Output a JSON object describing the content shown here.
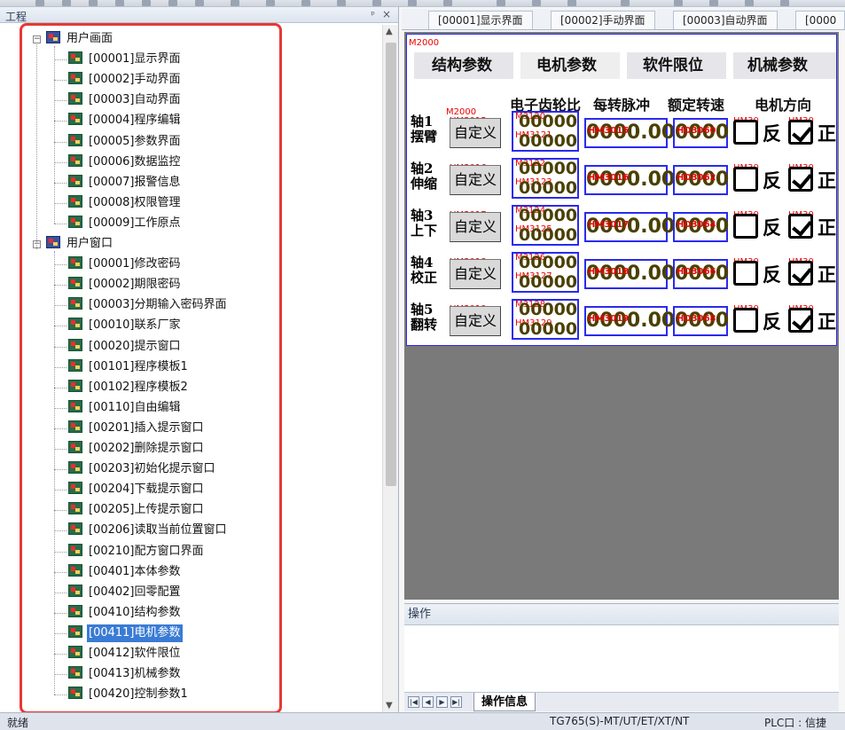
{
  "pane": {
    "title": "工程",
    "pin": "ᵖ",
    "close": "×"
  },
  "tree": {
    "groups": [
      {
        "label": "用户画面",
        "items": [
          "[00001]显示界面",
          "[00002]手动界面",
          "[00003]自动界面",
          "[00004]程序编辑",
          "[00005]参数界面",
          "[00006]数据监控",
          "[00007]报警信息",
          "[00008]权限管理",
          "[00009]工作原点"
        ]
      },
      {
        "label": "用户窗口",
        "items": [
          "[00001]修改密码",
          "[00002]期限密码",
          "[00003]分期输入密码界面",
          "[00010]联系厂家",
          "[00020]提示窗口",
          "[00101]程序模板1",
          "[00102]程序模板2",
          "[00110]自由编辑",
          "[00201]插入提示窗口",
          "[00202]删除提示窗口",
          "[00203]初始化提示窗口",
          "[00204]下载提示窗口",
          "[00205]上传提示窗口",
          "[00206]读取当前位置窗口",
          "[00210]配方窗口界面",
          "[00401]本体参数",
          "[00402]回零配置",
          "[00410]结构参数",
          "[00411]电机参数",
          "[00412]软件限位",
          "[00413]机械参数",
          "[00420]控制参数1"
        ]
      }
    ],
    "selected": "[00411]电机参数"
  },
  "doc_tabs": [
    "[00001]显示界面",
    "[00002]手动界面",
    "[00003]自动界面",
    "[0000"
  ],
  "screen": {
    "tag_top": "M2000",
    "page_tabs": [
      "结构参数",
      "电机参数",
      "软件限位",
      "机械参数"
    ],
    "active_page_tab": "电机参数",
    "col_headers": [
      "电子齿轮比",
      "每转脉冲",
      "额定转速",
      "电机方向"
    ],
    "tag_btn_row1": "M2000",
    "custom_label": "自定义",
    "gear_value": "00000",
    "pulse_value": "0000.00",
    "speed_value": "0000",
    "dir_reverse": "反",
    "dir_forward": "正",
    "axes": [
      {
        "num": "轴1",
        "name": "摆臂",
        "btn_tag": "HM3015",
        "g_tag1": "M3120",
        "g_tag2": "HM3121",
        "p_tag": "HM3015",
        "s_tag": "HD3060",
        "c_tag1": "HM30",
        "c_tag2": "HM30"
      },
      {
        "num": "轴2",
        "name": "伸缩",
        "btn_tag": "HM3016",
        "g_tag1": "M3122",
        "g_tag2": "HM3123",
        "p_tag": "HM3016",
        "s_tag": "HD3062",
        "c_tag1": "HM30",
        "c_tag2": "HM30"
      },
      {
        "num": "轴3",
        "name": "上下",
        "btn_tag": "HM3017",
        "g_tag1": "M3124",
        "g_tag2": "HM3125",
        "p_tag": "HM3017",
        "s_tag": "HD3064",
        "c_tag1": "HM30",
        "c_tag2": "HM30"
      },
      {
        "num": "轴4",
        "name": "校正",
        "btn_tag": "HM3018",
        "g_tag1": "M3126",
        "g_tag2": "HM3127",
        "p_tag": "HM3018",
        "s_tag": "HD3066",
        "c_tag1": "HM30",
        "c_tag2": "HM30"
      },
      {
        "num": "轴5",
        "name": "翻转",
        "btn_tag": "HM3019",
        "g_tag1": "M3128",
        "g_tag2": "HM3129",
        "p_tag": "HM3019",
        "s_tag": "HD3068",
        "c_tag1": "HM30",
        "c_tag2": "HM30"
      }
    ]
  },
  "operation": {
    "title": "操作",
    "tab": "操作信息"
  },
  "status": {
    "left": "就绪",
    "model": "TG765(S)-MT/UT/ET/XT/NT",
    "plc": "PLC口 : 信捷"
  },
  "colors": {
    "selection": "#3a7bd5",
    "frame_blue": "#2a2af0",
    "annot_red": "#e53935",
    "canvas_gray": "#7a7a7a"
  }
}
